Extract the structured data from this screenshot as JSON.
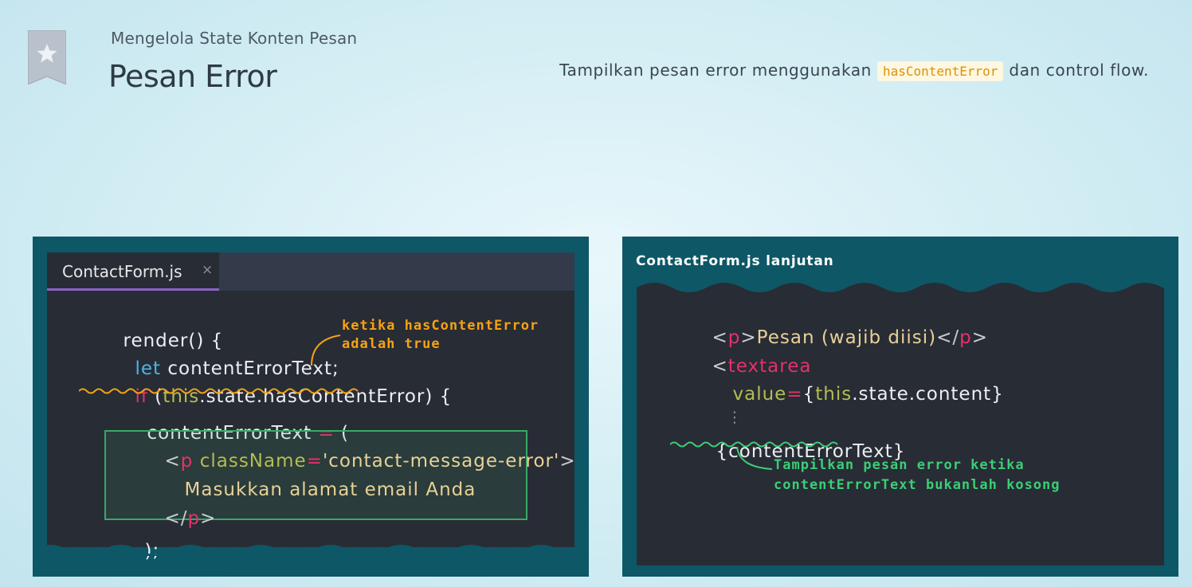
{
  "header": {
    "subtitle": "Mengelola State Konten Pesan",
    "title": "Pesan Error",
    "instruction_before": "Tampilkan pesan error menggunakan",
    "instruction_code": "hasContentError",
    "instruction_after": "dan control flow."
  },
  "left_panel": {
    "tab_label": "ContactForm.js",
    "tab_close": "×",
    "annotation_line1": "ketika hasContentError",
    "annotation_line2": "adalah true",
    "code": {
      "l1": "render() {",
      "l2_kw": "let",
      "l2_rest": " contentErrorText;",
      "l3_kw": "if",
      "l3_paren": " (",
      "l3_this": "this",
      "l3_rest": ".state.hasContentError) {",
      "l4_name": "contentErrorText ",
      "l4_eq": "=",
      "l4_paren": " (",
      "l5_lt": "<",
      "l5_tag": "p",
      "l5_attr": " className",
      "l5_eq": "=",
      "l5_val": "'contact-message-error'",
      "l5_gt": ">",
      "l6": "Masukkan alamat email Anda",
      "l7_lt": "</",
      "l7_tag": "p",
      "l7_gt": ">",
      "l8": ");"
    }
  },
  "right_panel": {
    "title": "ContactForm.js lanjutan",
    "annotation_line1": "Tampilkan pesan error ketika",
    "annotation_line2": "contentErrorText bukanlah kosong",
    "code": {
      "l1_lt": "<",
      "l1_tag": "p",
      "l1_gt": ">",
      "l1_text": "Pesan (wajib diisi)",
      "l1_close_lt": "</",
      "l1_close_tag": "p",
      "l1_close_gt": ">",
      "l2_lt": "<",
      "l2_tag": "textarea",
      "l3_attr": "value",
      "l3_eq": "=",
      "l3_open": "{",
      "l3_this": "this",
      "l3_rest": ".state.content}",
      "l4": "⋮",
      "l5": "{contentErrorText}"
    }
  },
  "colors": {
    "panel_bg": "#0e5766",
    "editor_bg": "#282c35",
    "orange_annotation": "#f6a214",
    "green_annotation": "#3bce76"
  },
  "icons": {
    "bookmark": "star-bookmark-icon",
    "tab_close": "close-icon"
  }
}
